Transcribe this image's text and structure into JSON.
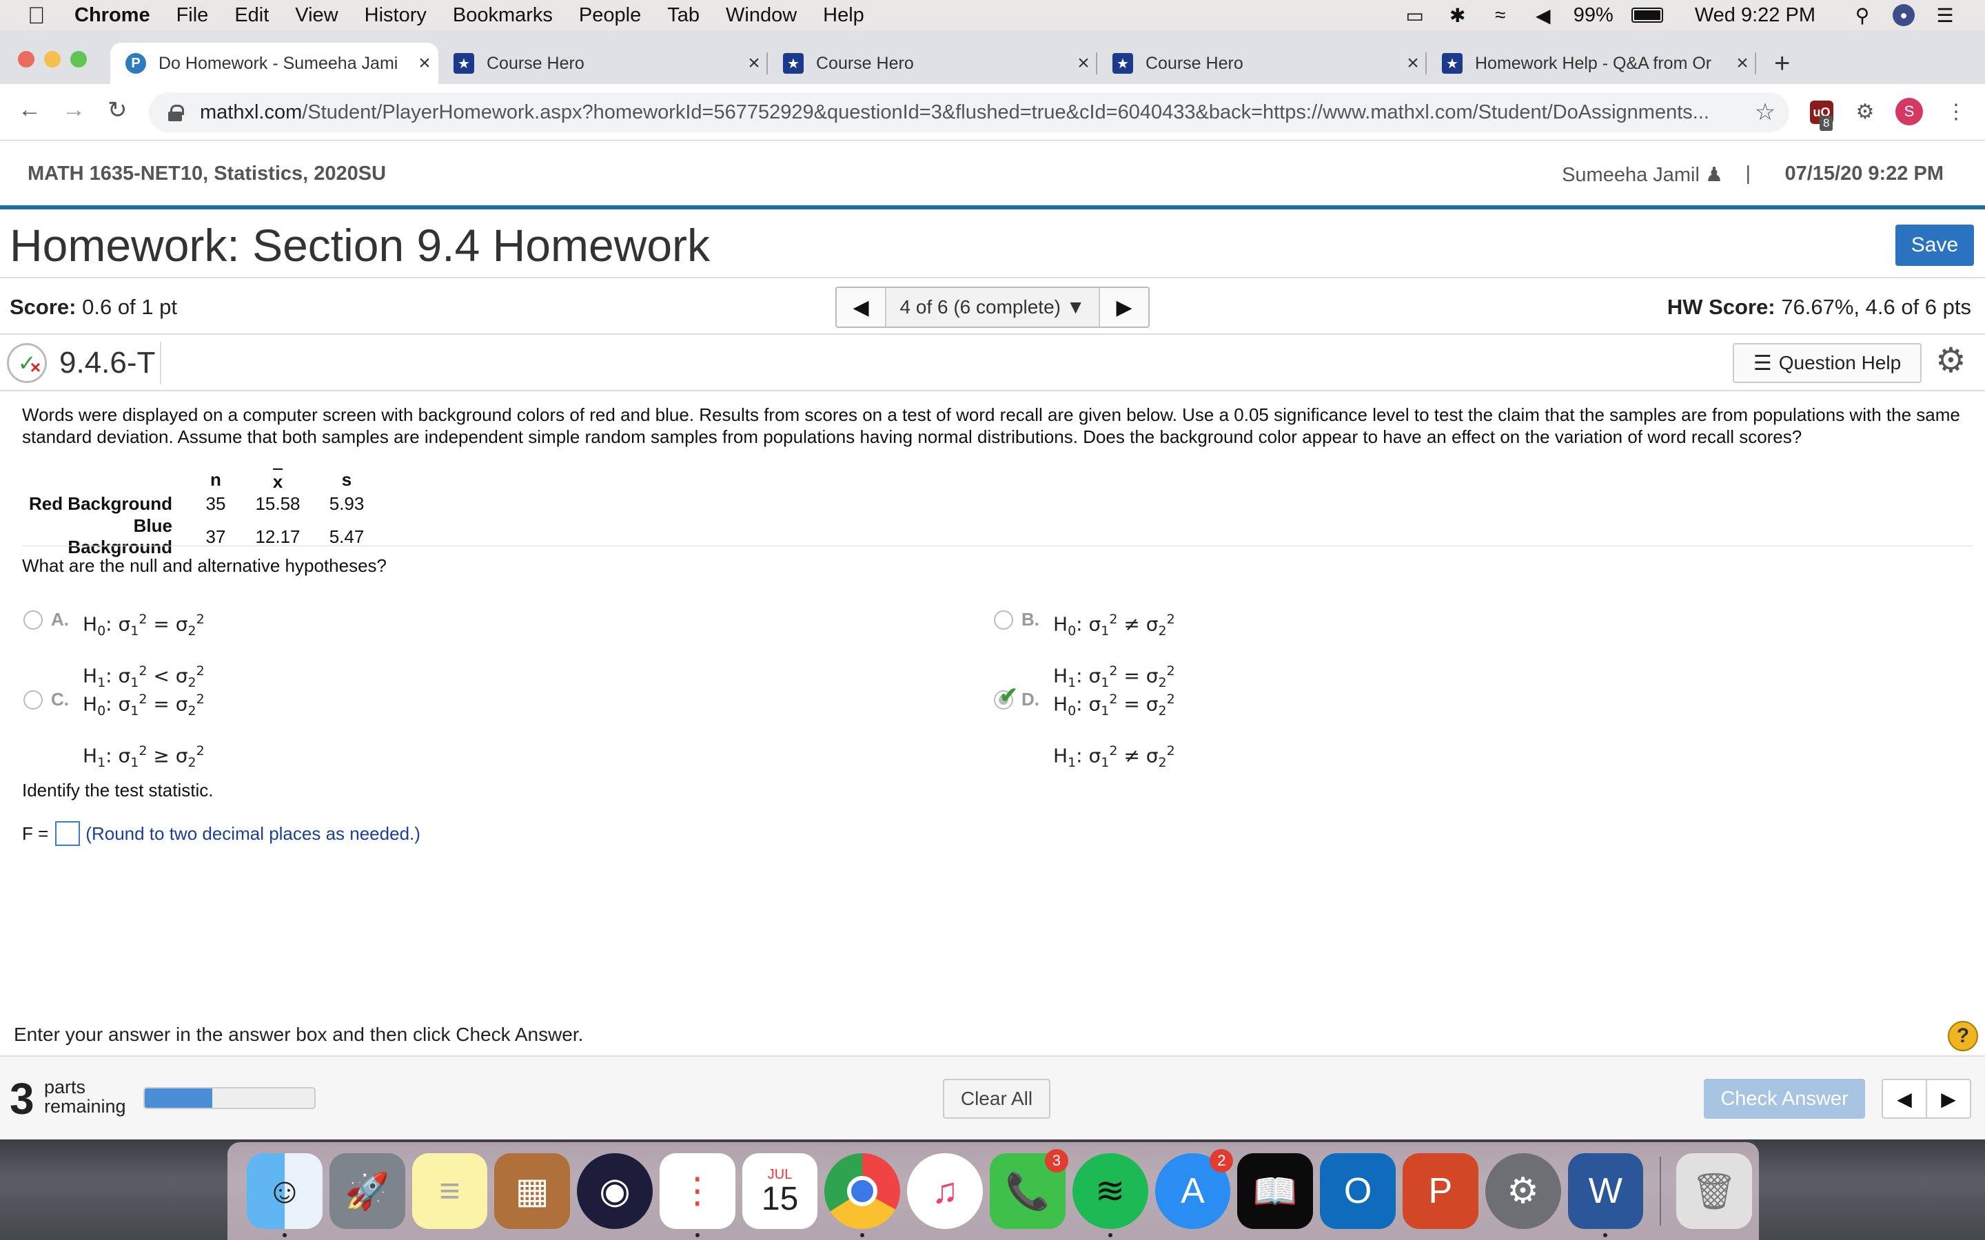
{
  "menubar": {
    "app": "Chrome",
    "menus": [
      "File",
      "Edit",
      "View",
      "History",
      "Bookmarks",
      "People",
      "Tab",
      "Window",
      "Help"
    ],
    "battery": "99%",
    "clock": "Wed 9:22 PM"
  },
  "tabs": [
    {
      "title": "Do Homework - Sumeeha Jami",
      "active": true
    },
    {
      "title": "Course Hero",
      "active": false
    },
    {
      "title": "Course Hero",
      "active": false
    },
    {
      "title": "Course Hero",
      "active": false
    },
    {
      "title": "Homework Help - Q&A from Or",
      "active": false
    }
  ],
  "address": {
    "domain": "mathxl.com",
    "path": "/Student/PlayerHomework.aspx?homeworkId=567752929&questionId=3&flushed=true&cId=6040433&back=https://www.mathxl.com/Student/DoAssignments..."
  },
  "extensions": {
    "badge": "8",
    "avatar": "S"
  },
  "header": {
    "course": "MATH 1635-NET10, Statistics, 2020SU",
    "user": "Sumeeha Jamil",
    "date": "07/15/20 9:22 PM"
  },
  "homework": {
    "title": "Homework: Section 9.4 Homework",
    "save_label": "Save",
    "score_label": "Score:",
    "score_value": "0.6 of 1 pt",
    "nav_text": "4 of 6 (6 complete)",
    "hw_score_label": "HW Score:",
    "hw_score_value": "76.67%, 4.6 of 6 pts",
    "question_id": "9.4.6-T",
    "question_help": "Question Help"
  },
  "problem": {
    "text": "Words were displayed on a computer screen with background colors of red and blue. Results from scores on a test of word recall are given below. Use a 0.05 significance level to test the claim that the samples are from populations with the same standard deviation. Assume that both samples are independent simple random samples from populations having normal distributions. Does the background color appear to have an effect on the variation of word recall scores?",
    "table": {
      "headers": [
        "n",
        "x",
        "s"
      ],
      "rows": [
        {
          "label": "Red Background",
          "n": "35",
          "x": "15.58",
          "s": "5.93"
        },
        {
          "label": "Blue Background",
          "n": "37",
          "x": "12.17",
          "s": "5.47"
        }
      ]
    },
    "hyp_prompt": "What are the null and alternative hypotheses?",
    "choices": [
      {
        "letter": "A.",
        "h0": "=",
        "h1": "<",
        "selected": false
      },
      {
        "letter": "B.",
        "h0": "≠",
        "h1": "=",
        "selected": false
      },
      {
        "letter": "C.",
        "h0": "=",
        "h1": "≥",
        "selected": false
      },
      {
        "letter": "D.",
        "h0": "=",
        "h1": "≠",
        "selected": true
      }
    ],
    "stat_prompt": "Identify the test statistic.",
    "f_label": "F =",
    "f_value": "",
    "f_hint": "(Round to two decimal places as needed.)"
  },
  "footer": {
    "instruction": "Enter your answer in the answer box and then click Check Answer.",
    "parts_count": "3",
    "parts_line1": "parts",
    "parts_line2": "remaining",
    "progress_fraction": 0.4,
    "clear_all": "Clear All",
    "check_answer": "Check Answer"
  },
  "dock": {
    "calendar_month": "JUL",
    "calendar_day": "15",
    "facetime_badge": "3",
    "appstore_badge": "2"
  }
}
